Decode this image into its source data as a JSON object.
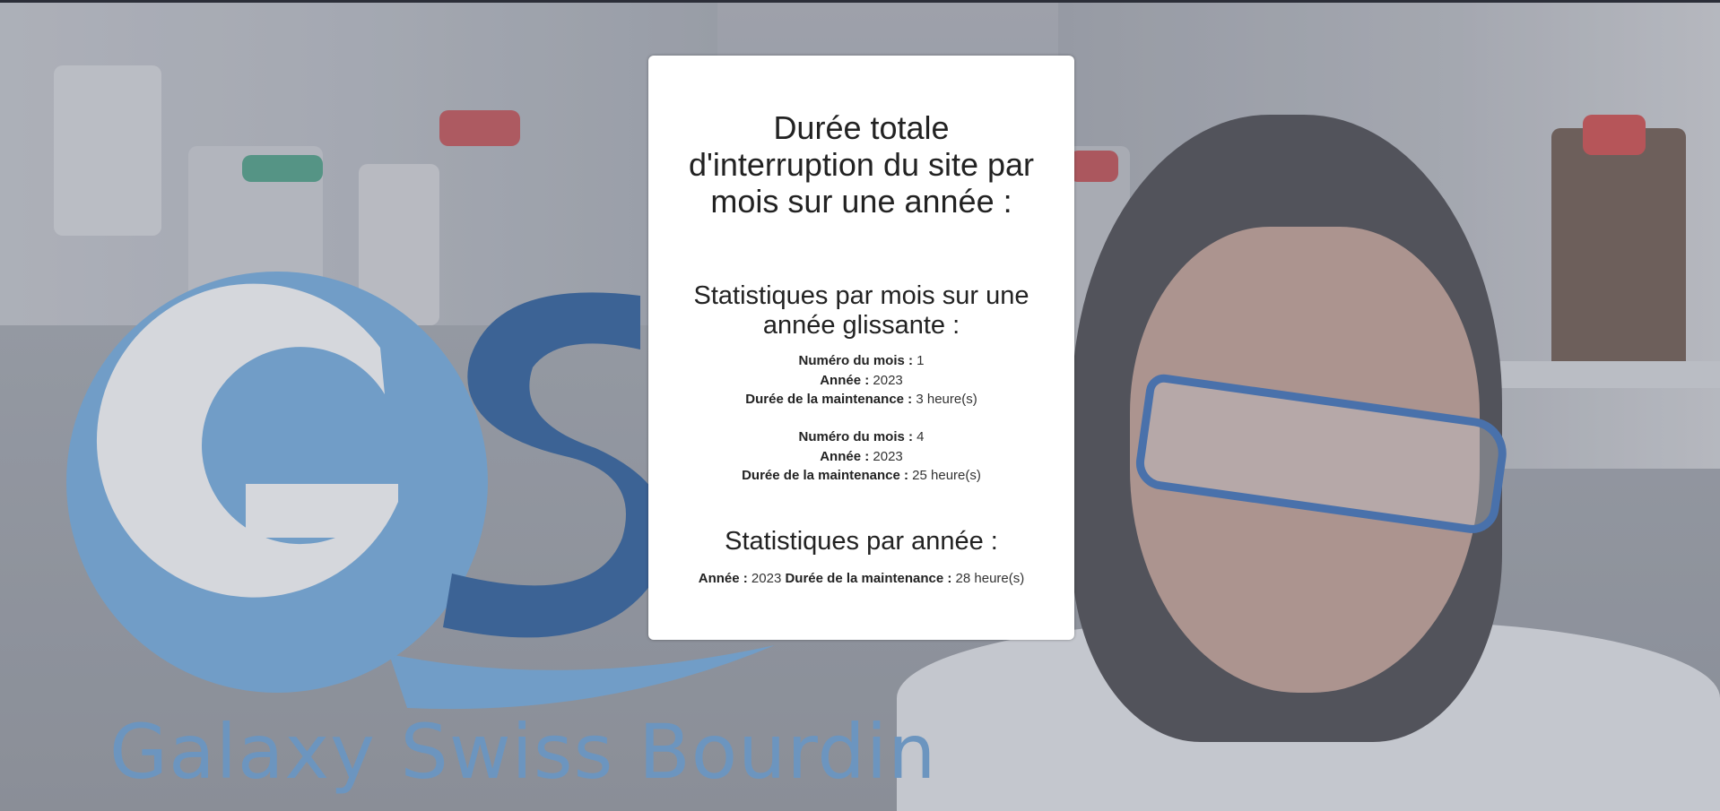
{
  "page": {
    "title": "Durée totale d'interruption du site par mois sur une année :"
  },
  "background": {
    "logo_text": "Galaxy Swiss Bourdin",
    "logo_letters": "GSB"
  },
  "monthly": {
    "title": "Statistiques par mois sur une année glissante :",
    "label_month": "Numéro du mois :",
    "label_year": "Année :",
    "label_duration": "Durée de la maintenance :",
    "records": [
      {
        "month": "1",
        "year": "2023",
        "duration": "3 heure(s)"
      },
      {
        "month": "4",
        "year": "2023",
        "duration": "25 heure(s)"
      }
    ]
  },
  "yearly": {
    "title": "Statistiques par année :",
    "label_year": "Année :",
    "label_duration": "Durée de la maintenance :",
    "year": "2023",
    "duration": "28 heure(s)"
  },
  "colors": {
    "logo_light_blue": "#6fa5d6",
    "logo_dark_blue": "#2f5f99",
    "card_bg": "#ffffff",
    "goggles_blue": "#3f6fb4"
  }
}
